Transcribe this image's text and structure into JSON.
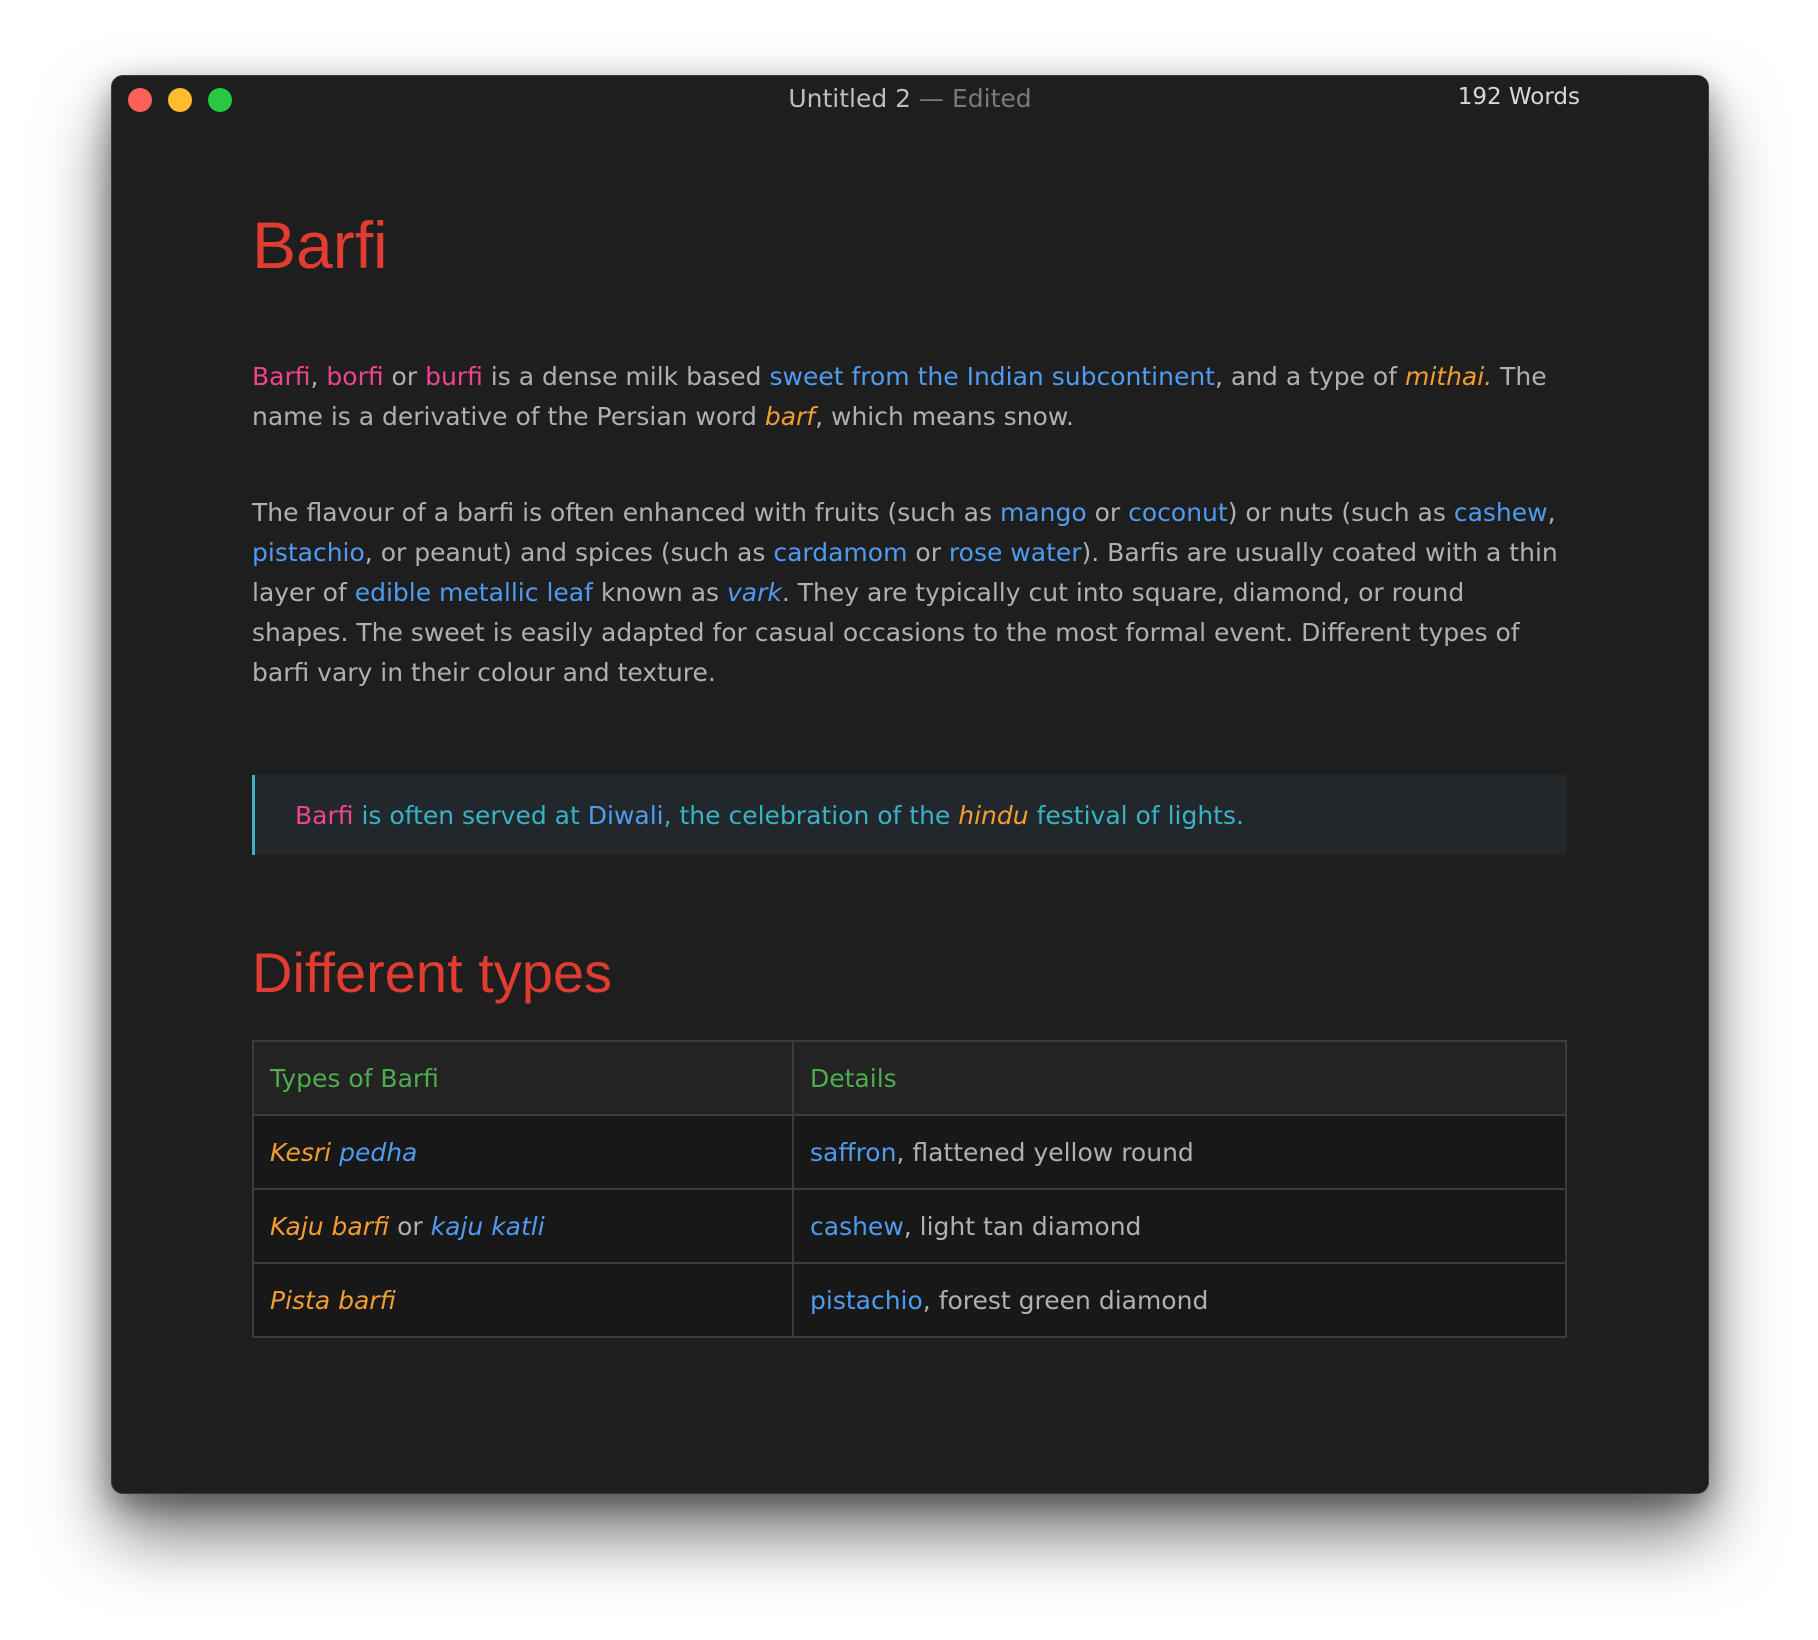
{
  "window": {
    "title": "Untitled 2",
    "title_sep": " — ",
    "title_status": "Edited",
    "word_count": "192 Words"
  },
  "doc": {
    "h1": "Barfi",
    "p1": {
      "t1": "Barfi",
      "t2": ", ",
      "t3": "borfi",
      "t4": " or ",
      "t5": "burfi",
      "t6": " is a dense milk based ",
      "t7": "sweet from the Indian subcontinent",
      "t8": ", and a type of ",
      "t9": "mithai.",
      "t10": " The name is a derivative of the Persian word ",
      "t11": "barf",
      "t12": ", which means snow."
    },
    "p2": {
      "t1": "The flavour of a barfi is often enhanced with fruits (such as ",
      "t2": "mango",
      "t3": " or ",
      "t4": "coconut",
      "t5": ") or nuts (such as ",
      "t6": "cashew",
      "t7": ", ",
      "t8": "pistachio",
      "t9": ", or peanut) and spices (such as ",
      "t10": "cardamom",
      "t11": " or ",
      "t12": "rose water",
      "t13": "). Barfis are usually coated with a thin layer of ",
      "t14": "edible metallic leaf",
      "t15": " known as ",
      "t16": "vark",
      "t17": ". They are typically cut into square, diamond, or round shapes. The sweet is easily adapted for casual occasions to the most formal event. Different types of barfi vary in their colour and texture."
    },
    "quote": {
      "t1": "Barfi",
      "t2": " is often served at ",
      "t3": "Diwali",
      "t4": ", the celebration of the ",
      "t5": "hindu",
      "t6": " festival of lights."
    },
    "h2": "Different types",
    "table": {
      "headers": [
        "Types of Barfi",
        "Details"
      ],
      "rows": [
        {
          "a1": "Kesri",
          "a2": " ",
          "a3": "pedha",
          "b1": "saffron",
          "b2": ", flattened yellow round"
        },
        {
          "a1": "Kaju barfi",
          "a2": " or ",
          "a3": "kaju katli",
          "b1": "cashew",
          "b2": ", light tan diamond"
        },
        {
          "a1": "Pista barfi",
          "a2": "",
          "a3": "",
          "b1": "pistachio",
          "b2": ", forest green diamond"
        }
      ]
    }
  },
  "colors": {
    "background": "#1e1e1e",
    "heading": "#e03c31",
    "body_text": "#b0b0b0",
    "bold_pink": "#f0448e",
    "link_blue": "#4f9bf0",
    "italic_orange": "#f59c31",
    "quote_teal": "#38b3c6",
    "table_header_green": "#4cae4c"
  }
}
